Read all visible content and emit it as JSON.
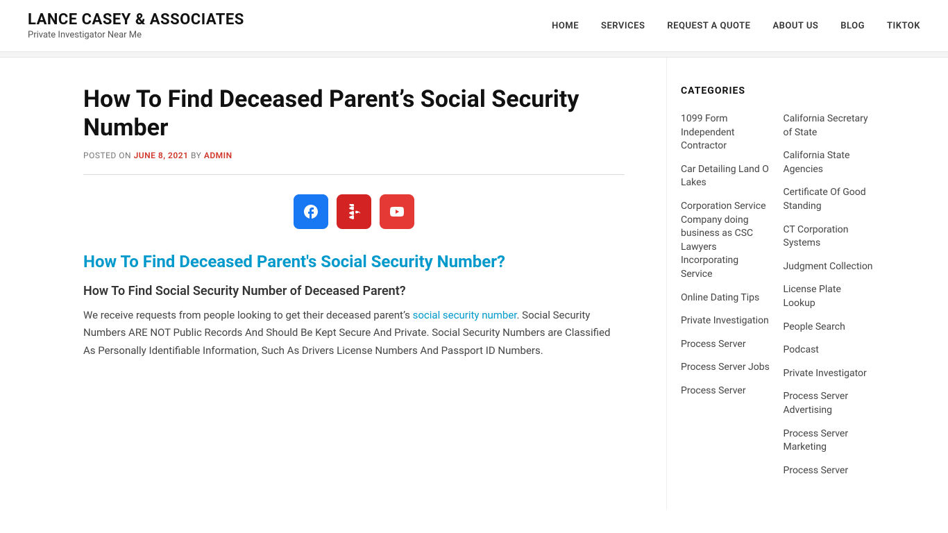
{
  "header": {
    "brand_name": "LANCE CASEY & ASSOCIATES",
    "brand_tagline": "Private Investigator Near Me",
    "nav_items": [
      {
        "label": "HOME",
        "id": "home"
      },
      {
        "label": "SERVICES",
        "id": "services"
      },
      {
        "label": "REQUEST A QUOTE",
        "id": "request-quote"
      },
      {
        "label": "ABOUT US",
        "id": "about-us"
      },
      {
        "label": "BLOG",
        "id": "blog"
      },
      {
        "label": "TIKTOK",
        "id": "tiktok"
      }
    ]
  },
  "article": {
    "title": "How To Find Deceased Parent’s Social Security Number",
    "meta_prefix": "POSTED ON",
    "meta_date": "JUNE 8, 2021",
    "meta_by": "BY",
    "meta_author": "ADMIN",
    "heading_blue": "How To Find Deceased Parent's Social Security Number?",
    "subheading": "How To Find Social Security Number of Deceased Parent?",
    "body_intro": "We receive requests from people looking to get their deceased parent’s",
    "body_link": "social security number",
    "body_text": ".  Social Security Numbers ARE NOT Public Records And Should Be Kept Secure And Private. Social Security Numbers are Classified As Personally Identifiable Information, Such As Drivers License Numbers And Passport ID Numbers."
  },
  "social": {
    "facebook_label": "Facebook",
    "yelp_label": "Yelp",
    "youtube_label": "YouTube"
  },
  "sidebar": {
    "title": "CATEGORIES",
    "col1": [
      "1099 Form Independent Contractor",
      "Car Detailing Land O Lakes",
      "Corporation Service Company doing business as CSC Lawyers Incorporating Service",
      "",
      "Online Dating Tips",
      "",
      "Private Investigation",
      "Process Server",
      "",
      "Process Server Jobs",
      "Process Server"
    ],
    "col2": [
      "California Secretary of State",
      "California State Agencies",
      "Certificate Of Good Standing",
      "CT Corporation Systems",
      "Judgment Collection",
      "License Plate Lookup",
      "People Search",
      "Podcast",
      "Private Investigator",
      "",
      "Process Server Advertising",
      "",
      "Process Server Marketing",
      "Process Server"
    ],
    "items_left": [
      {
        "label": "1099 Form Independent Contractor"
      },
      {
        "label": "Car Detailing Land O Lakes"
      },
      {
        "label": "Corporation Service Company doing business as CSC Lawyers Incorporating Service"
      },
      {
        "label": "Online Dating Tips"
      },
      {
        "label": "Private Investigation"
      },
      {
        "label": "Process Server"
      },
      {
        "label": "Process Server Jobs"
      },
      {
        "label": "Process Server"
      }
    ],
    "items_right": [
      {
        "label": "California Secretary of State"
      },
      {
        "label": "California State Agencies"
      },
      {
        "label": "Certificate Of Good Standing"
      },
      {
        "label": "CT Corporation Systems"
      },
      {
        "label": "Judgment Collection"
      },
      {
        "label": "License Plate Lookup"
      },
      {
        "label": "People Search"
      },
      {
        "label": "Podcast"
      },
      {
        "label": "Private Investigator"
      },
      {
        "label": "Process Server Advertising"
      },
      {
        "label": "Process Server Marketing"
      },
      {
        "label": "Process Server"
      }
    ]
  }
}
